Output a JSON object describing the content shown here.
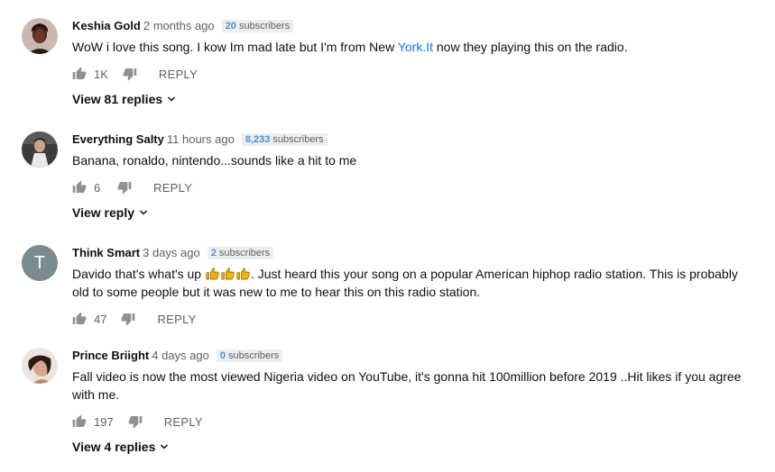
{
  "comments": [
    {
      "author": "Keshia Gold",
      "time": "2 months ago",
      "subs_count": "20",
      "subs_label": "subscribers",
      "text_before": "WoW i love this song. I kow Im mad late but I'm from New ",
      "text_link": "York.It",
      "text_after": " now they playing this on the radio.",
      "likes": "1K",
      "reply_label": "REPLY",
      "view_replies": "View 81 replies"
    },
    {
      "author": "Everything Salty",
      "time": "11 hours ago",
      "subs_count": "8,233",
      "subs_label": "subscribers",
      "text": "Banana, ronaldo, nintendo...sounds like a hit to me",
      "likes": "6",
      "reply_label": "REPLY",
      "view_replies": "View reply"
    },
    {
      "author": "Think Smart",
      "time": "3 days ago",
      "subs_count": "2",
      "subs_label": "subscribers",
      "avatar_letter": "T",
      "text_before": "Davido that's what's up ",
      "text_after": ". Just heard this your song on a popular American hiphop radio station. This is probably old to some people but it was new to me to hear this on this radio station.",
      "likes": "47",
      "reply_label": "REPLY"
    },
    {
      "author": "Prince Briight",
      "time": "4 days ago",
      "subs_count": "0",
      "subs_label": "subscribers",
      "text": "Fall video is now the most viewed Nigeria video on YouTube, it's gonna hit 100million before 2019 ..Hit likes if you agree with me.",
      "likes": "197",
      "reply_label": "REPLY",
      "view_replies": "View 4 replies"
    }
  ],
  "colors": {
    "link": "#1a73e8",
    "subs_count": "#4a90d6",
    "meta": "#606060",
    "letter_avatar": "#7b8b93"
  }
}
